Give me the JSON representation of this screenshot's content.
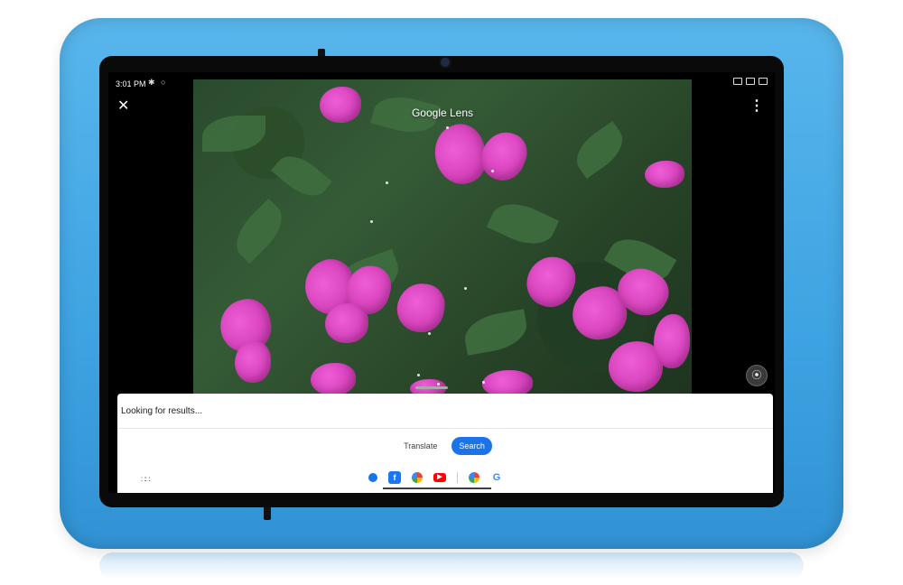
{
  "status_bar": {
    "time": "3:01 PM"
  },
  "lens": {
    "title": "Google Lens"
  },
  "sheet": {
    "status": "Looking for results...",
    "modes": {
      "translate": "Translate",
      "search": "Search"
    },
    "share_apps": [
      "messages-icon",
      "facebook-icon",
      "photos-icon",
      "youtube-icon",
      "photos-icon",
      "google-icon"
    ],
    "apps_icon": "apps-grid-icon"
  },
  "colors": {
    "case": "#3ea3e2",
    "accent": "#1a73e8",
    "petal": "#e34bcb"
  }
}
